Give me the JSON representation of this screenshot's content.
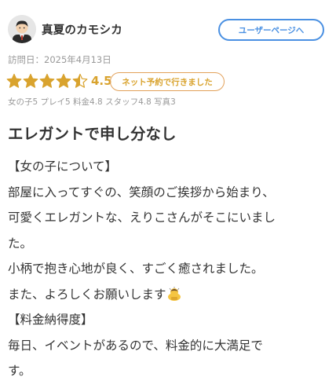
{
  "header": {
    "username": "真夏のカモシカ",
    "user_page_button": "ユーザーページへ"
  },
  "visit": {
    "date_text": "訪問日：2025年4月13日"
  },
  "rating": {
    "score": "4.5",
    "stars_value": 4.5,
    "stars_max": 5,
    "star_color": "#d9a32e",
    "badge_text": "ネット予約で行きました",
    "sub_scores_text": "女の子5 プレイ5 料金4.8 スタッフ4.8 写真3"
  },
  "review": {
    "title": "エレガントで申し分なし",
    "lines": [
      "【女の子について】",
      "部屋に入ってすぐの、笑顔のご挨拶から始まり、",
      "可愛くエレガントな、えりこさんがそこにいまし",
      "た。",
      "小柄で抱き心地が良く、すごく癒されました。",
      "また、よろしくお願いします",
      "【料金納得度】",
      "毎日、イベントがあるので、料金的に大満足で",
      "す。"
    ],
    "emoji_icon": "bowing-person-icon"
  },
  "colors": {
    "accent_blue": "#4a90e2",
    "star_gold": "#d9a32e",
    "badge_border": "#e2a15a",
    "muted_text": "#999999"
  }
}
